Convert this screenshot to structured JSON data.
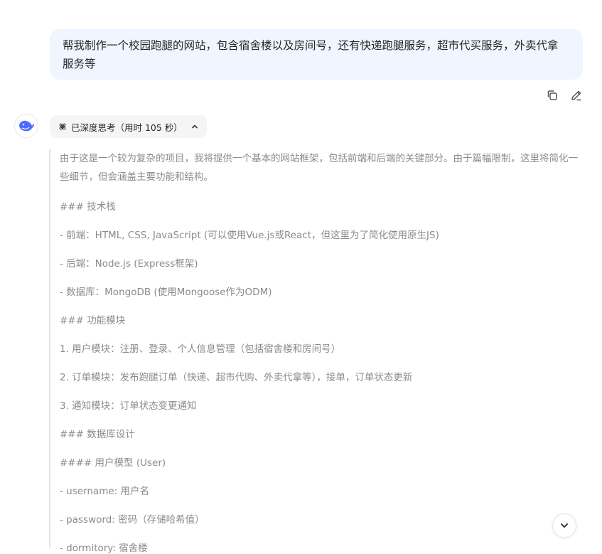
{
  "user_message": "帮我制作一个校园跑腿的网站，包含宿舍楼以及房间号，还有快递跑腿服务，超市代买服务，外卖代拿服务等",
  "thinking": {
    "toggle_label": "已深度思考（用时 105 秒）",
    "lines": [
      "由于这是一个较为复杂的项目，我将提供一个基本的网站框架，包括前端和后端的关键部分。由于篇幅限制，这里将简化一些细节，但会涵盖主要功能和结构。",
      "### 技术栈",
      "- 前端：HTML, CSS, JavaScript (可以使用Vue.js或React，但这里为了简化使用原生JS)",
      "- 后端：Node.js (Express框架)",
      "- 数据库：MongoDB (使用Mongoose作为ODM)",
      "### 功能模块",
      "1. 用户模块：注册、登录、个人信息管理（包括宿舍楼和房间号）",
      "2. 订单模块：发布跑腿订单（快递、超市代购、外卖代拿等），接单，订单状态更新",
      "3. 通知模块：订单状态变更通知",
      "### 数据库设计",
      "#### 用户模型 (User)",
      "- username: 用户名",
      "- password: 密码（存储哈希值）",
      "- dormitory: 宿舍楼"
    ]
  },
  "icons": {
    "copy": "copy-icon",
    "edit": "edit-icon",
    "avatar": "whale-logo-icon",
    "thinking": "atom-icon",
    "chevron_up": "chevron-up-icon",
    "chevron_down": "chevron-down-icon"
  },
  "colors": {
    "user_bubble": "#eff6ff",
    "brand": "#4d6bfe",
    "thinking_text": "#8b8b8b"
  }
}
